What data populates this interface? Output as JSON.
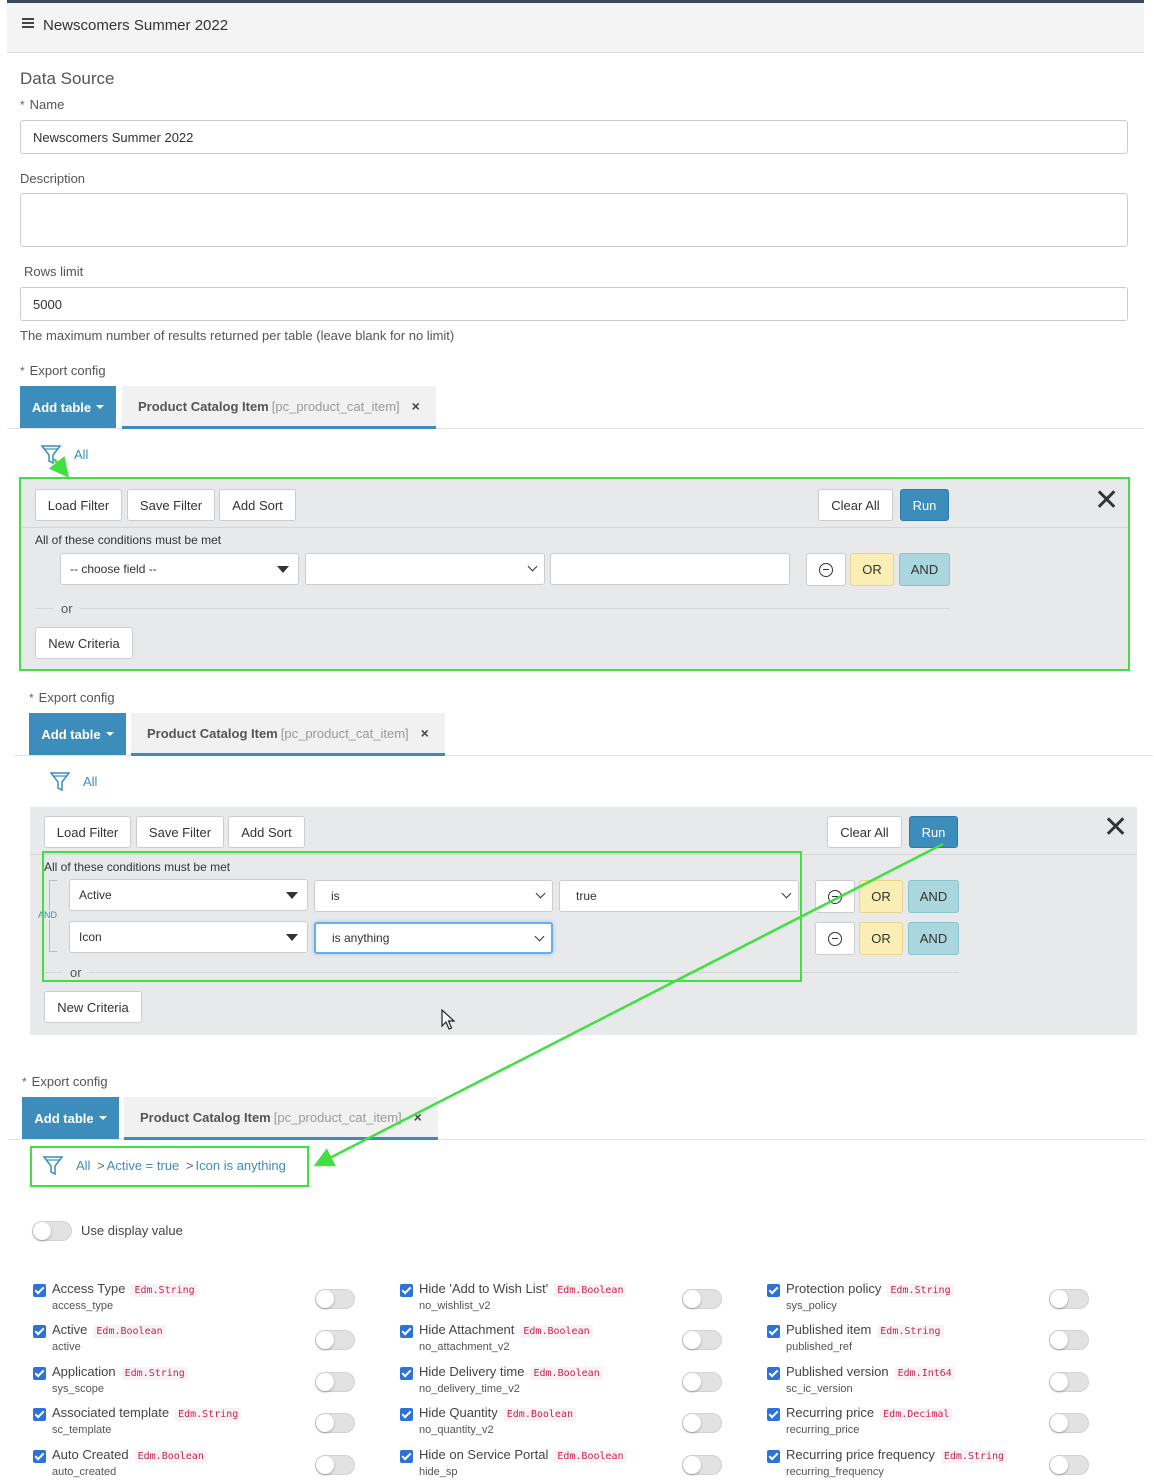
{
  "header": {
    "title": "Newscomers Summer 2022"
  },
  "form": {
    "section_title": "Data Source",
    "name_label": "Name",
    "name_value": "Newscomers Summer 2022",
    "description_label": "Description",
    "description_value": "",
    "rows_label": "Rows limit",
    "rows_value": "5000",
    "rows_help": "The maximum number of results returned per table (leave blank for no limit)",
    "export_label": "Export config",
    "required_mark": "*"
  },
  "tabs": {
    "add_table": "Add table",
    "tab_label": "Product Catalog Item",
    "tab_table": "[pc_product_cat_item]",
    "close": "×"
  },
  "filter": {
    "all_label": "All",
    "load_filter": "Load Filter",
    "save_filter": "Save Filter",
    "add_sort": "Add Sort",
    "clear_all": "Clear All",
    "run": "Run",
    "close": "✕",
    "conditions_title": "All of these conditions must be met",
    "or_label": "or",
    "and_label": "AND",
    "or_button": "OR",
    "and_button": "AND",
    "new_criteria": "New Criteria",
    "choose_field": "-- choose field --"
  },
  "conditions": [
    {
      "field": "Active",
      "operator": "is",
      "value": "true"
    },
    {
      "field": "Icon",
      "operator": "is anything",
      "value": ""
    }
  ],
  "breadcrumb": {
    "all": "All",
    "sep": ">",
    "c1": "Active = true",
    "c2": "Icon is anything"
  },
  "display_toggle": {
    "label": "Use display value"
  },
  "fields": [
    [
      {
        "name": "Access Type",
        "type": "Edm.String",
        "sys": "access_type"
      },
      {
        "name": "Active",
        "type": "Edm.Boolean",
        "sys": "active"
      },
      {
        "name": "Application",
        "type": "Edm.String",
        "sys": "sys_scope"
      },
      {
        "name": "Associated template",
        "type": "Edm.String",
        "sys": "sc_template"
      },
      {
        "name": "Auto Created",
        "type": "Edm.Boolean",
        "sys": "auto_created"
      }
    ],
    [
      {
        "name": "Hide 'Add to Wish List'",
        "type": "Edm.Boolean",
        "sys": "no_wishlist_v2"
      },
      {
        "name": "Hide Attachment",
        "type": "Edm.Boolean",
        "sys": "no_attachment_v2"
      },
      {
        "name": "Hide Delivery time",
        "type": "Edm.Boolean",
        "sys": "no_delivery_time_v2"
      },
      {
        "name": "Hide Quantity",
        "type": "Edm.Boolean",
        "sys": "no_quantity_v2"
      },
      {
        "name": "Hide on Service Portal",
        "type": "Edm.Boolean",
        "sys": "hide_sp"
      }
    ],
    [
      {
        "name": "Protection policy",
        "type": "Edm.String",
        "sys": "sys_policy"
      },
      {
        "name": "Published item",
        "type": "Edm.String",
        "sys": "published_ref"
      },
      {
        "name": "Published version",
        "type": "Edm.Int64",
        "sys": "sc_ic_version"
      },
      {
        "name": "Recurring price",
        "type": "Edm.Decimal",
        "sys": "recurring_price"
      },
      {
        "name": "Recurring price frequency",
        "type": "Edm.String",
        "sys": "recurring_frequency"
      }
    ]
  ],
  "colors": {
    "accent": "#3c8dbc",
    "annotation": "#3fe03f",
    "or_button": "#fbeeb4",
    "and_button": "#a9d7dd",
    "checkbox": "#2d72d9",
    "type_tag": "#c7254e"
  }
}
